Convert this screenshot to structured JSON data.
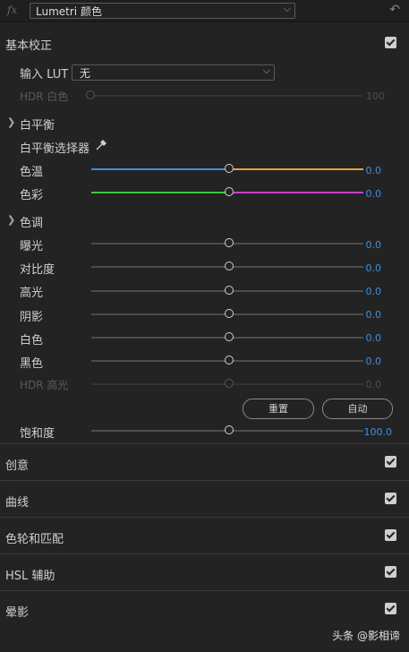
{
  "header": {
    "fx_label": "fx",
    "effect_name": "Lumetri 颜色"
  },
  "basic": {
    "title": "基本校正",
    "lut_label": "输入 LUT",
    "lut_value": "无",
    "hdr_white_label": "HDR 白色",
    "hdr_white_value": "100",
    "white_balance_title": "白平衡",
    "wb_selector_label": "白平衡选择器",
    "temperature_label": "色温",
    "temperature_value": "0.0",
    "tint_label": "色彩",
    "tint_value": "0.0",
    "tone_title": "色调",
    "tone": [
      {
        "label": "曝光",
        "value": "0.0"
      },
      {
        "label": "对比度",
        "value": "0.0"
      },
      {
        "label": "高光",
        "value": "0.0"
      },
      {
        "label": "阴影",
        "value": "0.0"
      },
      {
        "label": "白色",
        "value": "0.0"
      },
      {
        "label": "黑色",
        "value": "0.0"
      }
    ],
    "hdr_highlight_label": "HDR 高光",
    "hdr_highlight_value": "0.0",
    "reset_label": "重置",
    "auto_label": "自动",
    "saturation_label": "饱和度",
    "saturation_value": "100.0"
  },
  "sections": [
    {
      "label": "创意"
    },
    {
      "label": "曲线"
    },
    {
      "label": "色轮和匹配"
    },
    {
      "label": "HSL 辅助"
    },
    {
      "label": "晕影"
    }
  ],
  "watermark": "头条 @影相谛",
  "colors": {
    "value_blue": "#3d8fe0",
    "temp_left": "#3a8fd8",
    "temp_right": "#e8a040",
    "tint_left": "#3ec43e",
    "tint_right": "#c840c8"
  }
}
